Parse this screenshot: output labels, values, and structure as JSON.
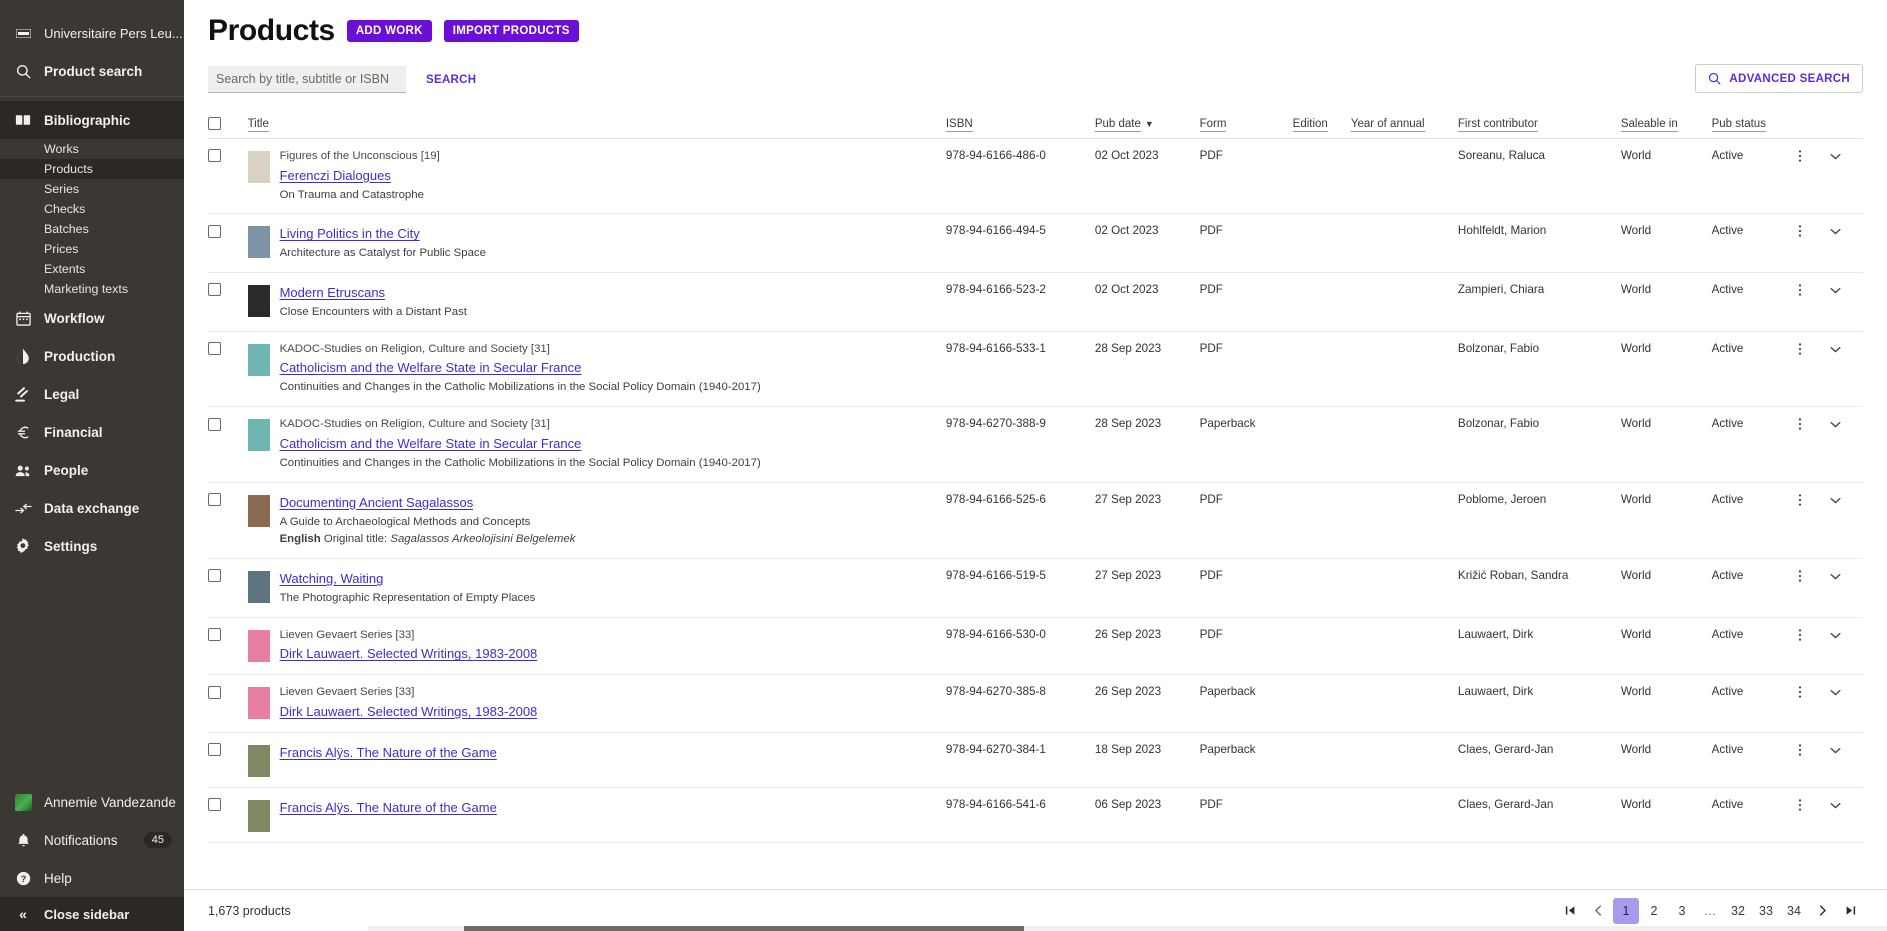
{
  "sidebar": {
    "org": {
      "label": "Universitaire Pers Leu...",
      "icon": "logo-icon"
    },
    "product_search": {
      "label": "Product search",
      "icon": "search-icon"
    },
    "groups": [
      {
        "label": "Bibliographic",
        "icon": "book-icon",
        "active": true,
        "items": [
          {
            "label": "Works",
            "active": false
          },
          {
            "label": "Products",
            "active": true
          },
          {
            "label": "Series",
            "active": false
          },
          {
            "label": "Checks",
            "active": false
          },
          {
            "label": "Batches",
            "active": false
          },
          {
            "label": "Prices",
            "active": false
          },
          {
            "label": "Extents",
            "active": false
          },
          {
            "label": "Marketing texts",
            "active": false
          }
        ]
      }
    ],
    "nav": [
      {
        "label": "Workflow",
        "icon": "calendar-icon"
      },
      {
        "label": "Production",
        "icon": "droplet-icon"
      },
      {
        "label": "Legal",
        "icon": "gavel-icon"
      },
      {
        "label": "Financial",
        "icon": "euro-icon"
      },
      {
        "label": "People",
        "icon": "people-icon"
      },
      {
        "label": "Data exchange",
        "icon": "exchange-icon"
      },
      {
        "label": "Settings",
        "icon": "gear-icon"
      }
    ],
    "user": {
      "label": "Annemie Vandezande",
      "icon": "avatar"
    },
    "notifications": {
      "label": "Notifications",
      "count": "45",
      "icon": "bell-icon"
    },
    "help": {
      "label": "Help",
      "icon": "question-circle-icon"
    },
    "close": {
      "label": "Close sidebar",
      "icon": "chevrons-left-icon"
    }
  },
  "header": {
    "title": "Products",
    "add_work_label": "ADD WORK",
    "import_products_label": "IMPORT PRODUCTS",
    "accent_color": "#6b0fd7",
    "link_color": "#5b2bd6"
  },
  "search": {
    "placeholder": "Search by title, subtitle or ISBN",
    "value": "",
    "search_label": "SEARCH",
    "advanced_label": "ADVANCED SEARCH"
  },
  "table": {
    "columns": [
      "Title",
      "ISBN",
      "Pub date",
      "Form",
      "Edition",
      "Year of annual",
      "First contributor",
      "Saleable in",
      "Pub status"
    ],
    "sorted_column": "Pub date",
    "sort_indicator": "▼",
    "rows": [
      {
        "series": "Figures of the Unconscious [19]",
        "title": "Ferenczi Dialogues",
        "subtitle": "On Trauma and Catastrophe",
        "original": "",
        "isbn": "978-94-6166-486-0",
        "pub_date": "02 Oct 2023",
        "form": "PDF",
        "edition": "",
        "year_of_annual": "",
        "contributor": "Soreanu, Raluca",
        "saleable_in": "World",
        "pub_status": "Active",
        "cover": "#d8d2c4"
      },
      {
        "series": "",
        "title": "Living Politics in the City",
        "subtitle": "Architecture as Catalyst for Public Space",
        "original": "",
        "isbn": "978-94-6166-494-5",
        "pub_date": "02 Oct 2023",
        "form": "PDF",
        "edition": "",
        "year_of_annual": "",
        "contributor": "Hohlfeldt, Marion",
        "saleable_in": "World",
        "pub_status": "Active",
        "cover": "#7f93a8"
      },
      {
        "series": "",
        "title": "Modern Etruscans",
        "subtitle": "Close Encounters with a Distant Past",
        "original": "",
        "isbn": "978-94-6166-523-2",
        "pub_date": "02 Oct 2023",
        "form": "PDF",
        "edition": "",
        "year_of_annual": "",
        "contributor": "Zampieri, Chiara",
        "saleable_in": "World",
        "pub_status": "Active",
        "cover": "#2a2a28"
      },
      {
        "series": "KADOC-Studies on Religion, Culture and Society [31]",
        "title": "Catholicism and the Welfare State in Secular France",
        "subtitle": "Continuities and Changes in the Catholic Mobilizations in the Social Policy Domain (1940-2017)",
        "original": "",
        "isbn": "978-94-6166-533-1",
        "pub_date": "28 Sep 2023",
        "form": "PDF",
        "edition": "",
        "year_of_annual": "",
        "contributor": "Bolzonar, Fabio",
        "saleable_in": "World",
        "pub_status": "Active",
        "cover": "#6fb5b0"
      },
      {
        "series": "KADOC-Studies on Religion, Culture and Society [31]",
        "title": "Catholicism and the Welfare State in Secular France",
        "subtitle": "Continuities and Changes in the Catholic Mobilizations in the Social Policy Domain (1940-2017)",
        "original": "",
        "isbn": "978-94-6270-388-9",
        "pub_date": "28 Sep 2023",
        "form": "Paperback",
        "edition": "",
        "year_of_annual": "",
        "contributor": "Bolzonar, Fabio",
        "saleable_in": "World",
        "pub_status": "Active",
        "cover": "#6fb5b0"
      },
      {
        "series": "",
        "title": "Documenting Ancient Sagalassos",
        "subtitle": "A Guide to Archaeological Methods and Concepts",
        "original_lang": "English",
        "original_label": "Original title:",
        "original_title": "Sagalassos Arkeolojisini Belgelemek",
        "isbn": "978-94-6166-525-6",
        "pub_date": "27 Sep 2023",
        "form": "PDF",
        "edition": "",
        "year_of_annual": "",
        "contributor": "Poblome, Jeroen",
        "saleable_in": "World",
        "pub_status": "Active",
        "cover": "#8a6b52"
      },
      {
        "series": "",
        "title": "Watching, Waiting",
        "subtitle": "The Photographic Representation of Empty Places",
        "original": "",
        "isbn": "978-94-6166-519-5",
        "pub_date": "27 Sep 2023",
        "form": "PDF",
        "edition": "",
        "year_of_annual": "",
        "contributor": "Križić Roban, Sandra",
        "saleable_in": "World",
        "pub_status": "Active",
        "cover": "#5e7380"
      },
      {
        "series": "Lieven Gevaert Series [33]",
        "title": "Dirk Lauwaert. Selected Writings, 1983-2008",
        "subtitle": "",
        "original": "",
        "isbn": "978-94-6166-530-0",
        "pub_date": "26 Sep 2023",
        "form": "PDF",
        "edition": "",
        "year_of_annual": "",
        "contributor": "Lauwaert, Dirk",
        "saleable_in": "World",
        "pub_status": "Active",
        "cover": "#e77fa0"
      },
      {
        "series": "Lieven Gevaert Series [33]",
        "title": "Dirk Lauwaert. Selected Writings, 1983-2008",
        "subtitle": "",
        "original": "",
        "isbn": "978-94-6270-385-8",
        "pub_date": "26 Sep 2023",
        "form": "Paperback",
        "edition": "",
        "year_of_annual": "",
        "contributor": "Lauwaert, Dirk",
        "saleable_in": "World",
        "pub_status": "Active",
        "cover": "#e77fa0"
      },
      {
        "series": "",
        "title": "Francis Alÿs. The Nature of the Game",
        "subtitle": "",
        "original": "",
        "isbn": "978-94-6270-384-1",
        "pub_date": "18 Sep 2023",
        "form": "Paperback",
        "edition": "",
        "year_of_annual": "",
        "contributor": "Claes, Gerard-Jan",
        "saleable_in": "World",
        "pub_status": "Active",
        "cover": "#7d8a63"
      },
      {
        "series": "",
        "title": "Francis Alÿs. The Nature of the Game",
        "subtitle": "",
        "original": "",
        "isbn": "978-94-6166-541-6",
        "pub_date": "06 Sep 2023",
        "form": "PDF",
        "edition": "",
        "year_of_annual": "",
        "contributor": "Claes, Gerard-Jan",
        "saleable_in": "World",
        "pub_status": "Active",
        "cover": "#7d8a63"
      }
    ]
  },
  "footer": {
    "count_label": "1,673 products",
    "pagination": {
      "first": "|◀",
      "prev": "‹",
      "pages": [
        "1",
        "2",
        "3",
        "…",
        "32",
        "33",
        "34"
      ],
      "current": "1",
      "next": "›",
      "last": "▶|"
    }
  }
}
